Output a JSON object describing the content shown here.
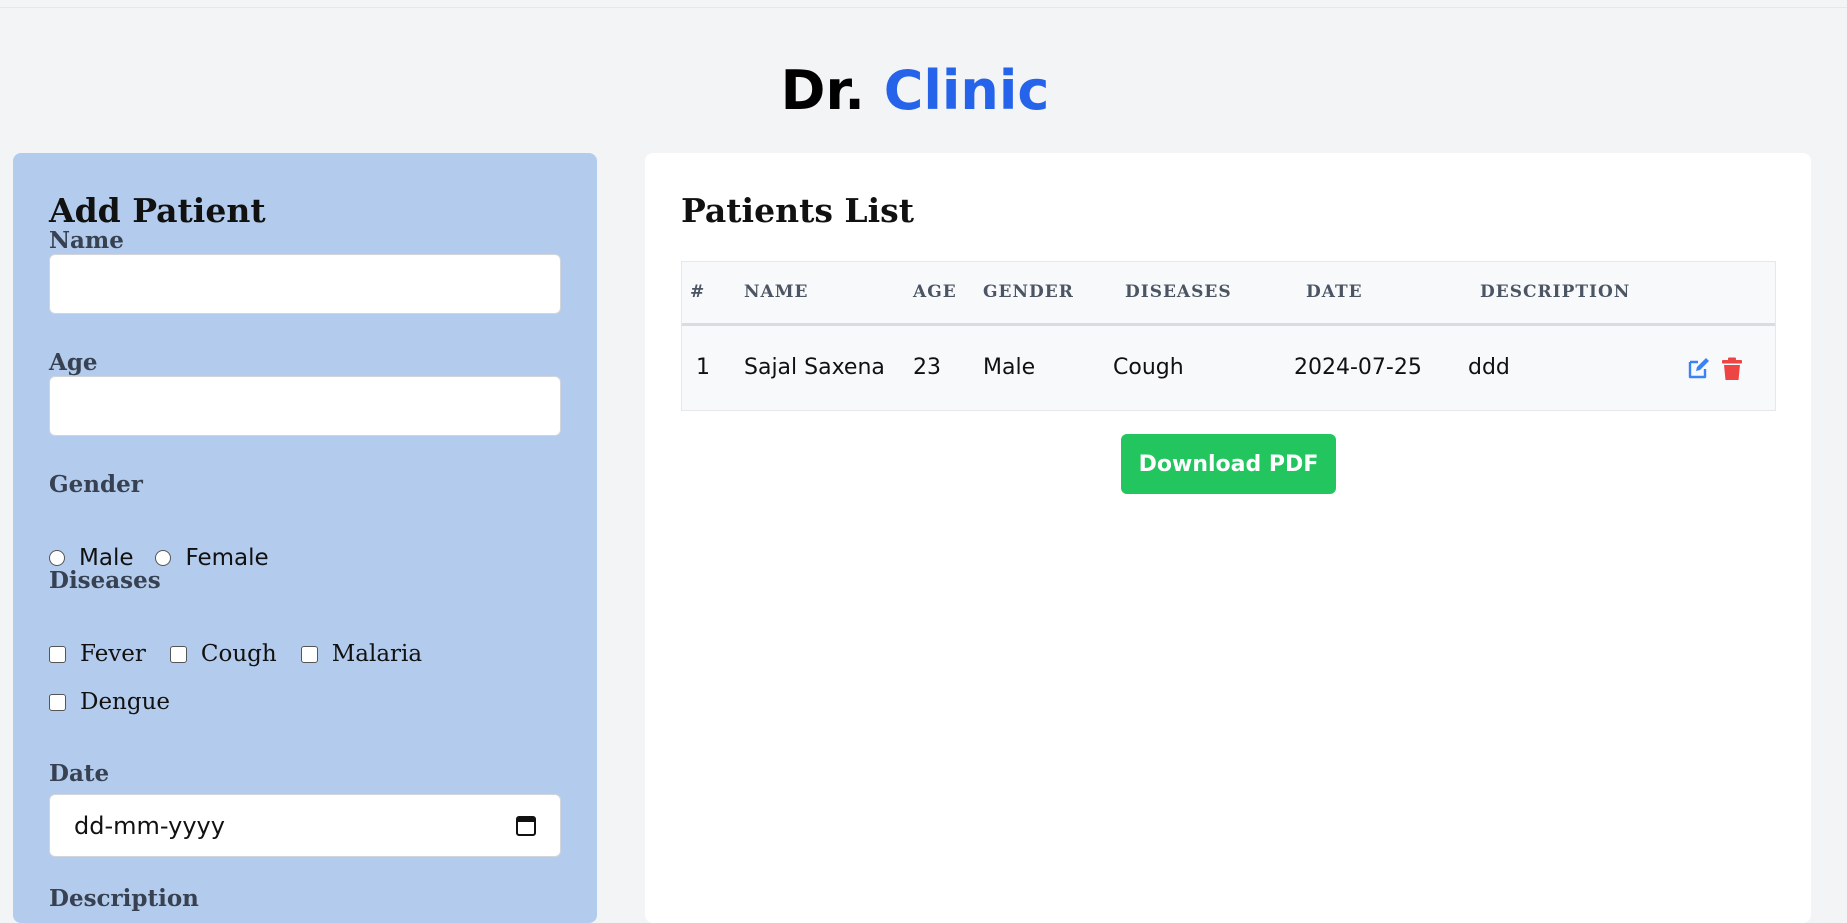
{
  "header": {
    "title_main": "Dr.",
    "title_accent": "Clinic"
  },
  "form": {
    "heading": "Add Patient",
    "name_label": "Name",
    "name_value": "",
    "age_label": "Age",
    "age_value": "",
    "gender_label": "Gender",
    "gender_options": [
      "Male",
      "Female"
    ],
    "diseases_label": "Diseases",
    "disease_options": [
      "Fever",
      "Cough",
      "Malaria",
      "Dengue"
    ],
    "date_label": "Date",
    "date_placeholder": "dd-mm-yyyy",
    "description_label": "Description"
  },
  "list": {
    "heading": "Patients List",
    "columns": [
      "#",
      "NAME",
      "AGE",
      "GENDER",
      "DISEASES",
      "DATE",
      "DESCRIPTION"
    ],
    "rows": [
      {
        "index": "1",
        "name": "Sajal Saxena",
        "age": "23",
        "gender": "Male",
        "diseases": "Cough",
        "date": "2024-07-25",
        "description": "ddd"
      }
    ],
    "download_label": "Download PDF"
  },
  "colors": {
    "accent": "#2563eb",
    "form_bg": "#b3cbec",
    "edit": "#3b82f6",
    "delete": "#ef4444",
    "download": "#22c55e"
  },
  "icons": {
    "edit": "edit-icon",
    "delete": "trash-icon",
    "calendar": "calendar-icon"
  }
}
